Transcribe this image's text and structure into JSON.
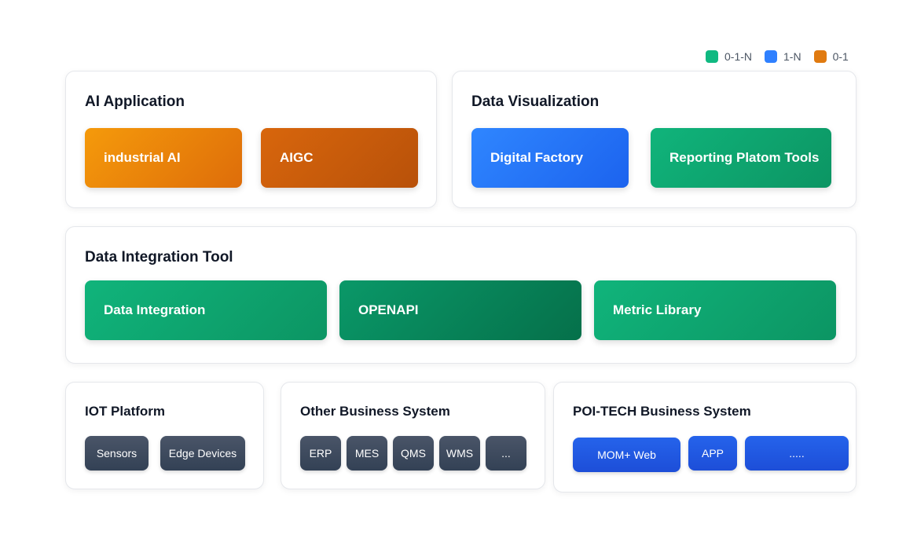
{
  "legend": [
    {
      "label": "0-1-N",
      "color": "#10b981"
    },
    {
      "label": "1-N",
      "color": "#2f80ff"
    },
    {
      "label": "0-1",
      "color": "#e07a10"
    }
  ],
  "ai_application": {
    "title": "AI Application",
    "items": [
      "industrial AI",
      "AIGC"
    ]
  },
  "data_visualization": {
    "title": "Data Visualization",
    "items": [
      "Digital Factory",
      "Reporting Platom Tools"
    ]
  },
  "data_integration_tool": {
    "title": "Data Integration Tool",
    "items": [
      "Data Integration",
      "OPENAPI",
      "Metric Library"
    ]
  },
  "iot_platform": {
    "title": "IOT Platform",
    "items": [
      "Sensors",
      "Edge Devices"
    ]
  },
  "other_business_system": {
    "title": "Other Business System",
    "items": [
      "ERP",
      "MES",
      "QMS",
      "WMS",
      "..."
    ]
  },
  "poi_tech_business_system": {
    "title": "POI-TECH Business System",
    "items": [
      "MOM+ Web",
      "APP",
      "....."
    ]
  }
}
